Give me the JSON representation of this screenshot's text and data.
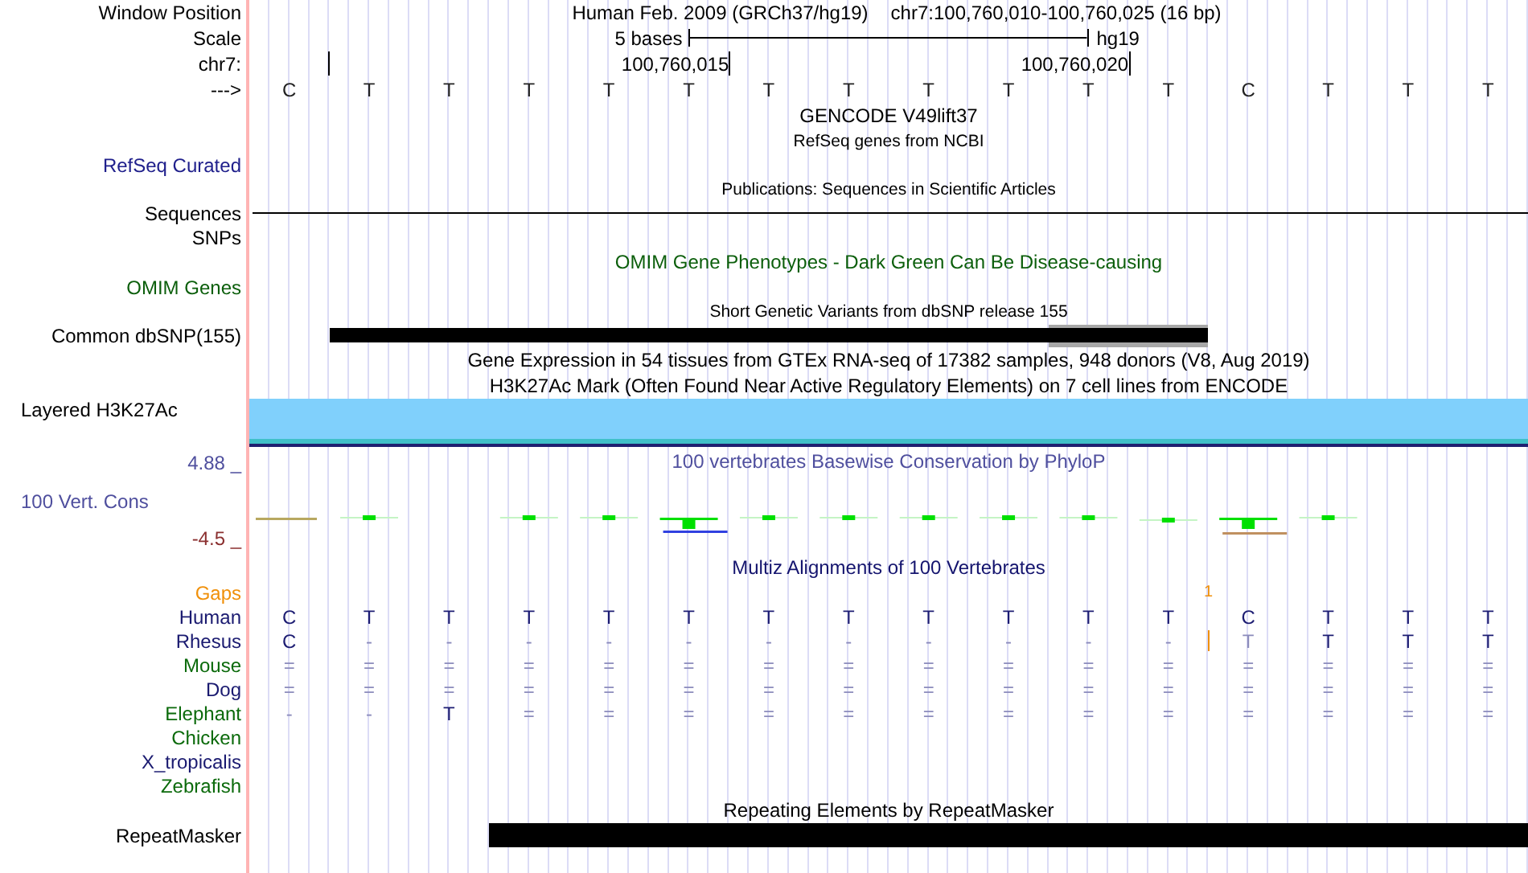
{
  "header": {
    "label": "Window Position",
    "assembly": "Human Feb. 2009 (GRCh37/hg19)",
    "position": "chr7:100,760,010-100,760,025 (16 bp)"
  },
  "scale": {
    "label": "Scale",
    "span": "5 bases",
    "assembly": "hg19"
  },
  "ruler": {
    "label": "chr7:",
    "ticks": [
      "100,760,015",
      "100,760,020"
    ]
  },
  "sequence": {
    "label": "--->",
    "bases": [
      "C",
      "T",
      "T",
      "T",
      "T",
      "T",
      "T",
      "T",
      "T",
      "T",
      "T",
      "T",
      "C",
      "T",
      "T",
      "T"
    ]
  },
  "tracks": [
    {
      "kind": "title",
      "text": "GENCODE V49lift37",
      "color": "#000000"
    },
    {
      "kind": "caption",
      "text": "RefSeq genes from NCBI"
    },
    {
      "kind": "label",
      "label": "RefSeq Curated",
      "color": "#20208c"
    },
    {
      "kind": "caption",
      "text": "Publications: Sequences in Scientific Articles"
    },
    {
      "kind": "line",
      "label": "Sequences",
      "color": "#000000"
    },
    {
      "kind": "label",
      "label": "SNPs",
      "color": "#000000"
    },
    {
      "kind": "title",
      "text": "OMIM Gene Phenotypes - Dark Green Can Be Disease-causing",
      "color": "#0b5e0b"
    },
    {
      "kind": "label",
      "label": "OMIM Genes",
      "color": "#0b5e0b"
    },
    {
      "kind": "caption",
      "text": "Short Genetic Variants from dbSNP release 155"
    },
    {
      "kind": "variants",
      "label": "Common dbSNP(155)",
      "color": "#000000"
    },
    {
      "kind": "title",
      "text": "Gene Expression in 54 tissues from GTEx RNA-seq of 17382 samples, 948 donors (V8, Aug 2019)",
      "color": "#000000"
    },
    {
      "kind": "title",
      "text": "H3K27Ac Mark (Often Found Near Active Regulatory Elements) on 7 cell lines from ENCODE",
      "color": "#000000"
    },
    {
      "kind": "band",
      "label": "Layered H3K27Ac",
      "color": "#000000"
    },
    {
      "kind": "wiggle",
      "label": "100 Vert. Cons",
      "title": "100 vertebrates Basewise Conservation by PhyloP",
      "max": "4.88 _",
      "min": "-4.5 _",
      "color": "#4f4f9e"
    },
    {
      "kind": "title",
      "text": "Multiz Alignments of 100 Vertebrates",
      "color": "#14146e"
    },
    {
      "kind": "gaps",
      "label": "Gaps",
      "mark": "1",
      "color": "#f0900a"
    },
    {
      "kind": "species",
      "label": "Human",
      "color": "#1a1a70",
      "bases": [
        {
          "b": "C",
          "dim": false
        },
        {
          "b": "T",
          "dim": false
        },
        {
          "b": "T",
          "dim": false
        },
        {
          "b": "T",
          "dim": false
        },
        {
          "b": "T",
          "dim": false
        },
        {
          "b": "T",
          "dim": false
        },
        {
          "b": "T",
          "dim": false
        },
        {
          "b": "T",
          "dim": false
        },
        {
          "b": "T",
          "dim": false
        },
        {
          "b": "T",
          "dim": false
        },
        {
          "b": "T",
          "dim": false
        },
        {
          "b": "T",
          "dim": false
        },
        {
          "b": "C",
          "dim": false
        },
        {
          "b": "T",
          "dim": false
        },
        {
          "b": "T",
          "dim": false
        },
        {
          "b": "T",
          "dim": false
        }
      ]
    },
    {
      "kind": "species",
      "label": "Rhesus",
      "color": "#1a1a70",
      "gap": true,
      "bases": [
        {
          "b": "C",
          "dim": false
        },
        {
          "b": "-",
          "dim": true
        },
        {
          "b": "-",
          "dim": true
        },
        {
          "b": "-",
          "dim": true
        },
        {
          "b": "-",
          "dim": true
        },
        {
          "b": "-",
          "dim": true
        },
        {
          "b": "-",
          "dim": true
        },
        {
          "b": "-",
          "dim": true
        },
        {
          "b": "-",
          "dim": true
        },
        {
          "b": "-",
          "dim": true
        },
        {
          "b": "-",
          "dim": true
        },
        {
          "b": "-",
          "dim": true
        },
        {
          "b": "T",
          "dim": true
        },
        {
          "b": "T",
          "dim": false
        },
        {
          "b": "T",
          "dim": false
        },
        {
          "b": "T",
          "dim": false
        }
      ]
    },
    {
      "kind": "species",
      "label": "Mouse",
      "color": "#0b6a0b",
      "bases": [
        {
          "b": "=",
          "dim": true
        },
        {
          "b": "=",
          "dim": true
        },
        {
          "b": "=",
          "dim": true
        },
        {
          "b": "=",
          "dim": true
        },
        {
          "b": "=",
          "dim": true
        },
        {
          "b": "=",
          "dim": true
        },
        {
          "b": "=",
          "dim": true
        },
        {
          "b": "=",
          "dim": true
        },
        {
          "b": "=",
          "dim": true
        },
        {
          "b": "=",
          "dim": true
        },
        {
          "b": "=",
          "dim": true
        },
        {
          "b": "=",
          "dim": true
        },
        {
          "b": "=",
          "dim": true
        },
        {
          "b": "=",
          "dim": true
        },
        {
          "b": "=",
          "dim": true
        },
        {
          "b": "=",
          "dim": true
        }
      ]
    },
    {
      "kind": "species",
      "label": "Dog",
      "color": "#1a1a70",
      "bases": [
        {
          "b": "=",
          "dim": true
        },
        {
          "b": "=",
          "dim": true
        },
        {
          "b": "=",
          "dim": true
        },
        {
          "b": "=",
          "dim": true
        },
        {
          "b": "=",
          "dim": true
        },
        {
          "b": "=",
          "dim": true
        },
        {
          "b": "=",
          "dim": true
        },
        {
          "b": "=",
          "dim": true
        },
        {
          "b": "=",
          "dim": true
        },
        {
          "b": "=",
          "dim": true
        },
        {
          "b": "=",
          "dim": true
        },
        {
          "b": "=",
          "dim": true
        },
        {
          "b": "=",
          "dim": true
        },
        {
          "b": "=",
          "dim": true
        },
        {
          "b": "=",
          "dim": true
        },
        {
          "b": "=",
          "dim": true
        }
      ]
    },
    {
      "kind": "species",
      "label": "Elephant",
      "color": "#0b6a0b",
      "bases": [
        {
          "b": "-",
          "dim": true
        },
        {
          "b": "-",
          "dim": true
        },
        {
          "b": "T",
          "dim": false
        },
        {
          "b": "=",
          "dim": true
        },
        {
          "b": "=",
          "dim": true
        },
        {
          "b": "=",
          "dim": true
        },
        {
          "b": "=",
          "dim": true
        },
        {
          "b": "=",
          "dim": true
        },
        {
          "b": "=",
          "dim": true
        },
        {
          "b": "=",
          "dim": true
        },
        {
          "b": "=",
          "dim": true
        },
        {
          "b": "=",
          "dim": true
        },
        {
          "b": "=",
          "dim": true
        },
        {
          "b": "=",
          "dim": true
        },
        {
          "b": "=",
          "dim": true
        },
        {
          "b": "=",
          "dim": true
        }
      ]
    },
    {
      "kind": "species",
      "label": "Chicken",
      "color": "#0b6a0b"
    },
    {
      "kind": "species",
      "label": "X_tropicalis",
      "color": "#1a1a70"
    },
    {
      "kind": "species",
      "label": "Zebrafish",
      "color": "#0b6a0b"
    },
    {
      "kind": "title",
      "text": "Repeating Elements by RepeatMasker",
      "color": "#000000"
    },
    {
      "kind": "repeat",
      "label": "RepeatMasker",
      "color": "#000000"
    }
  ]
}
